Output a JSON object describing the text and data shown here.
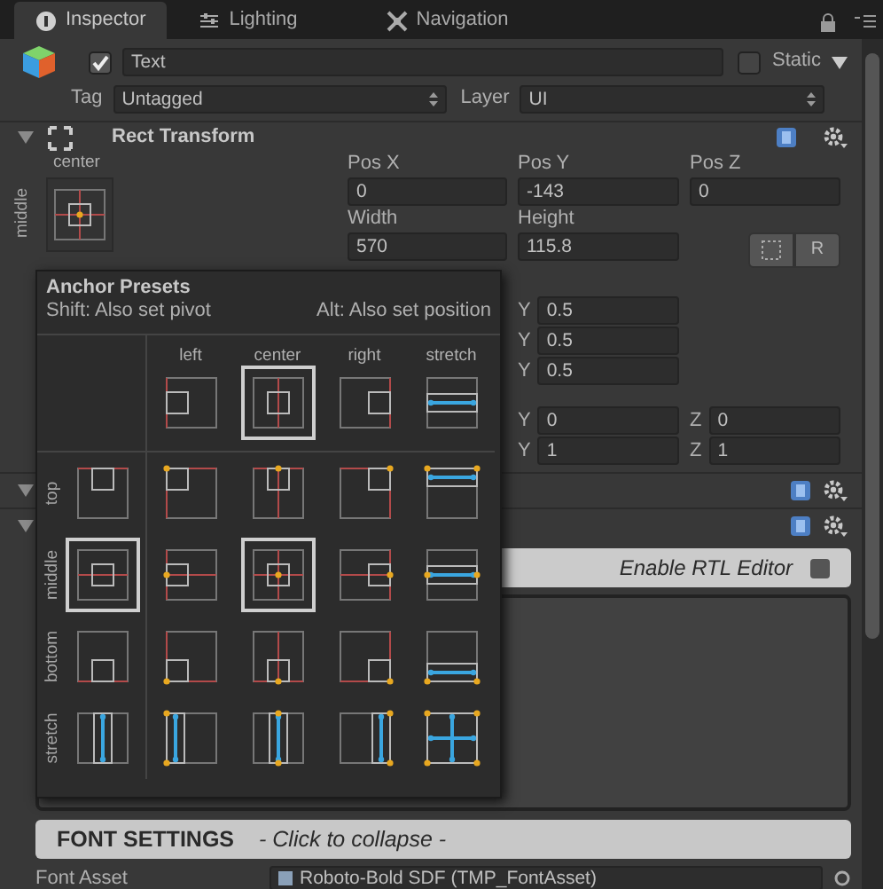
{
  "tabs": [
    {
      "label": "Inspector",
      "selected": true
    },
    {
      "label": "Lighting",
      "selected": false
    },
    {
      "label": "Navigation",
      "selected": false
    }
  ],
  "object": {
    "active": true,
    "name": "Text",
    "static": false,
    "static_label": "Static",
    "tag_label": "Tag",
    "tag": "Untagged",
    "layer_label": "Layer",
    "layer": "UI"
  },
  "rect_transform": {
    "title": "Rect Transform",
    "expanded": true,
    "anchor_h_label": "center",
    "anchor_v_label": "middle",
    "fields": [
      {
        "label": "Pos X",
        "value": "0"
      },
      {
        "label": "Pos Y",
        "value": "-143"
      },
      {
        "label": "Pos Z",
        "value": "0"
      },
      {
        "label": "Width",
        "value": "570"
      },
      {
        "label": "Height",
        "value": "115.8"
      }
    ],
    "raw_button": "R",
    "rows": [
      {
        "y": {
          "label": "Y",
          "value": "0.5"
        }
      },
      {
        "y": {
          "label": "Y",
          "value": "0.5"
        }
      },
      {
        "y": {
          "label": "Y",
          "value": "0.5"
        }
      },
      {
        "y": {
          "label": "Y",
          "value": "0"
        },
        "z": {
          "label": "Z",
          "value": "0"
        }
      },
      {
        "y": {
          "label": "Y",
          "value": "1"
        },
        "z": {
          "label": "Z",
          "value": "1"
        }
      }
    ]
  },
  "components": [
    {
      "expanded": true
    },
    {
      "expanded": true
    }
  ],
  "rtl": {
    "label": "Enable RTL Editor",
    "checked": false
  },
  "font_settings": {
    "title": "FONT SETTINGS",
    "hint": "- Click to collapse -"
  },
  "font_asset": {
    "label": "Font Asset",
    "value": "Roboto-Bold SDF (TMP_FontAsset)"
  },
  "anchor_presets": {
    "title": "Anchor Presets",
    "hints": [
      "Shift: Also set pivot",
      "Alt: Also set position"
    ],
    "column_labels": [
      "left",
      "center",
      "right",
      "stretch"
    ],
    "header_row": [
      {
        "selected": false
      },
      {
        "selected": true
      },
      {
        "selected": false
      },
      {
        "selected": false
      }
    ],
    "rows": [
      {
        "label": "top",
        "presets": [
          {
            "selected": false
          },
          {
            "selected": false
          },
          {
            "selected": false
          },
          {
            "selected": false
          },
          {
            "selected": false
          }
        ]
      },
      {
        "label": "middle",
        "presets": [
          {
            "selected": true
          },
          {
            "selected": false
          },
          {
            "selected": true
          },
          {
            "selected": false
          },
          {
            "selected": false
          }
        ]
      },
      {
        "label": "bottom",
        "presets": [
          {
            "selected": false
          },
          {
            "selected": false
          },
          {
            "selected": false
          },
          {
            "selected": false
          },
          {
            "selected": false
          }
        ]
      },
      {
        "label": "stretch",
        "presets": [
          {
            "selected": false
          },
          {
            "selected": false
          },
          {
            "selected": false
          },
          {
            "selected": false
          },
          {
            "selected": false
          }
        ]
      }
    ]
  }
}
